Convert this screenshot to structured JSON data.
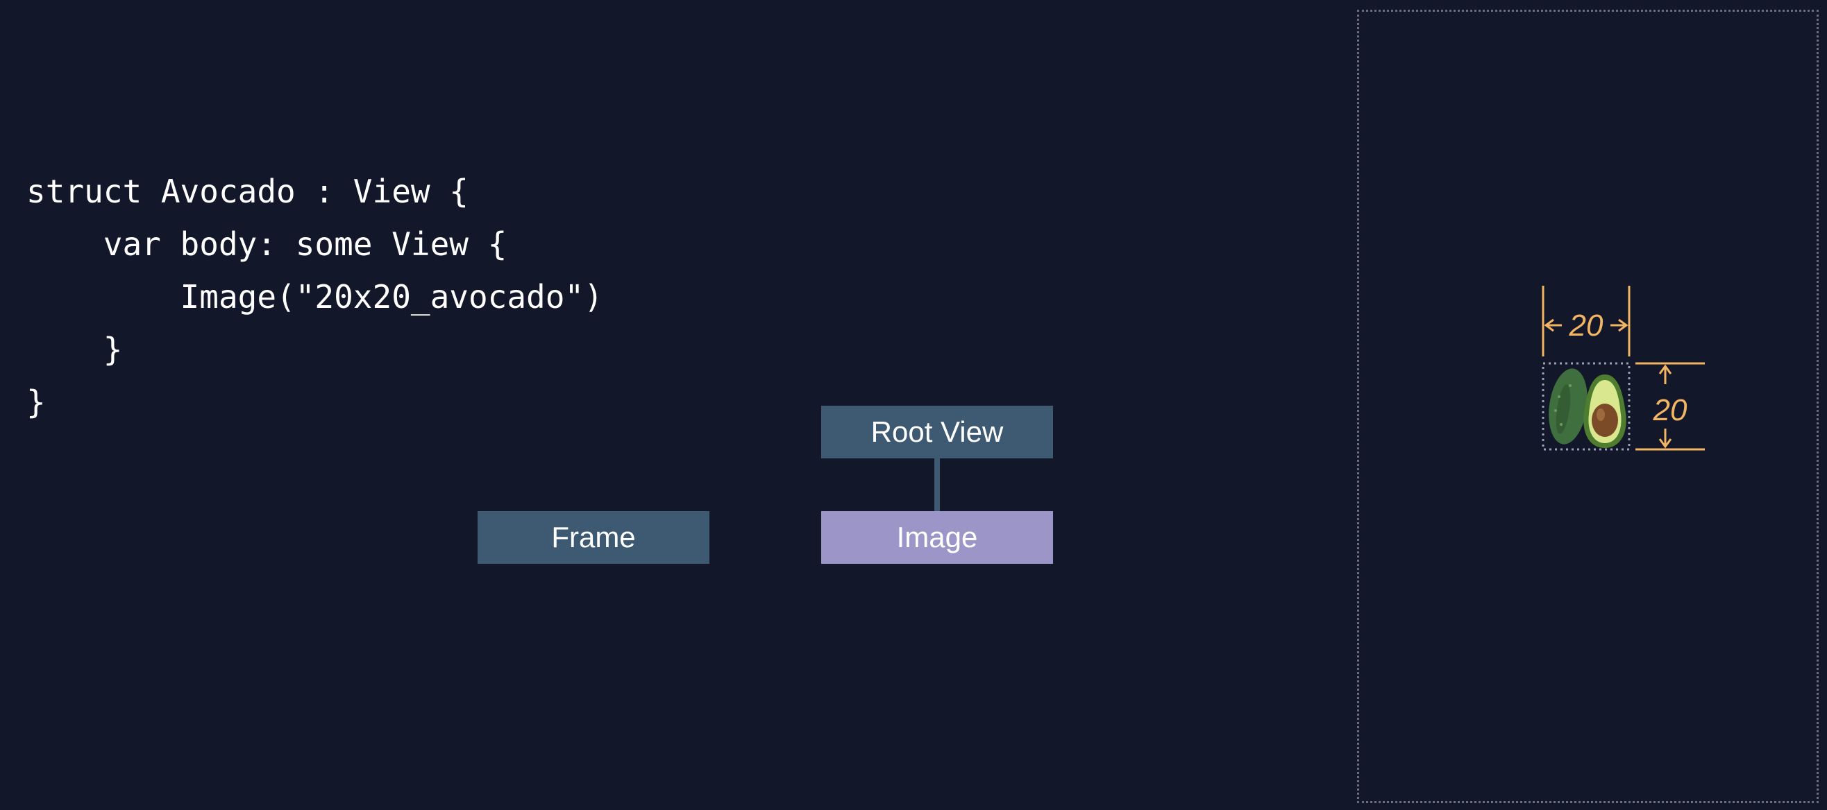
{
  "code": {
    "lines": [
      "struct Avocado : View {",
      "    var body: some View {",
      "        Image(\"20x20_avocado\")",
      "    }",
      "}"
    ]
  },
  "tree": {
    "root_label": "Root View",
    "image_label": "Image",
    "frame_label": "Frame",
    "colors": {
      "node": "#3e5a72",
      "image_node": "#9c95c7",
      "background": "#13172a"
    }
  },
  "preview": {
    "width_label": "20",
    "height_label": "20",
    "image_icon": "avocado-icon",
    "accent_color": "#f2b563"
  }
}
